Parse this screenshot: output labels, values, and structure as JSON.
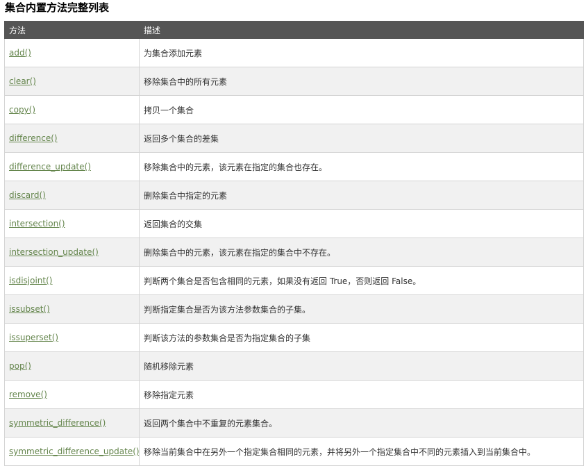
{
  "page": {
    "title": "集合内置方法完整列表"
  },
  "table": {
    "headers": [
      "方法",
      "描述"
    ],
    "rows": [
      {
        "method": "add()",
        "description": "为集合添加元素"
      },
      {
        "method": "clear()",
        "description": "移除集合中的所有元素"
      },
      {
        "method": "copy()",
        "description": "拷贝一个集合"
      },
      {
        "method": "difference()",
        "description": "返回多个集合的差集"
      },
      {
        "method": "difference_update()",
        "description": "移除集合中的元素，该元素在指定的集合也存在。"
      },
      {
        "method": "discard()",
        "description": "删除集合中指定的元素"
      },
      {
        "method": "intersection()",
        "description": "返回集合的交集"
      },
      {
        "method": "intersection_update()",
        "description": "删除集合中的元素，该元素在指定的集合中不存在。"
      },
      {
        "method": "isdisjoint()",
        "description": "判断两个集合是否包含相同的元素，如果没有返回 True，否则返回 False。"
      },
      {
        "method": "issubset()",
        "description": "判断指定集合是否为该方法参数集合的子集。"
      },
      {
        "method": "issuperset()",
        "description": "判断该方法的参数集合是否为指定集合的子集"
      },
      {
        "method": "pop()",
        "description": "随机移除元素"
      },
      {
        "method": "remove()",
        "description": "移除指定元素"
      },
      {
        "method": "symmetric_difference()",
        "description": "返回两个集合中不重复的元素集合。"
      },
      {
        "method": "symmetric_difference_update()",
        "description": "移除当前集合中在另外一个指定集合相同的元素，并将另外一个指定集合中不同的元素插入到当前集合中。"
      }
    ]
  },
  "colors": {
    "header_bg": "#555555",
    "link": "#64854c",
    "row_alt": "#f1f1f1"
  }
}
